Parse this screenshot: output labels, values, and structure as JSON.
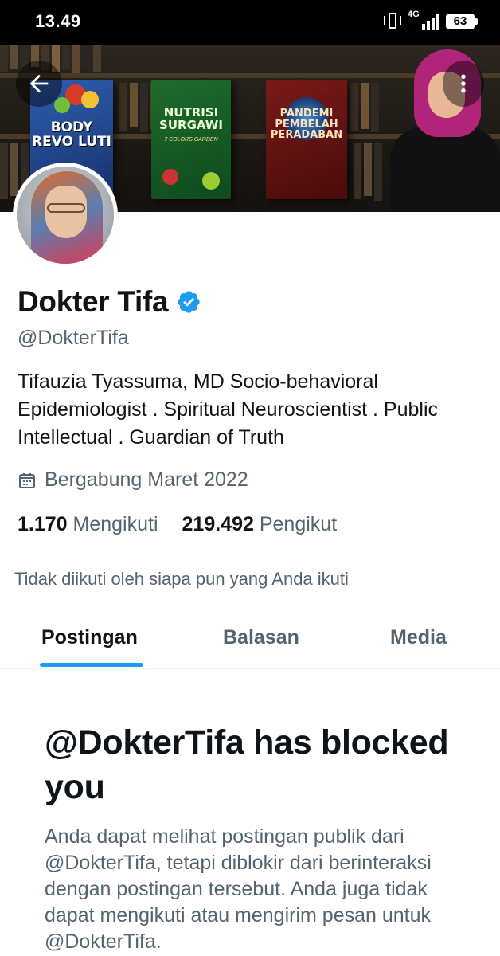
{
  "status_bar": {
    "time": "13.49",
    "network_label": "4G",
    "battery": "63"
  },
  "banner": {
    "books": [
      {
        "title": "BODY REVO LUTI",
        "subtitle": ""
      },
      {
        "title": "NUTRISI SURGAWI",
        "subtitle": "7 COLORS GARDEN"
      },
      {
        "title": "PANDEMI PEMBELAH PERADABAN",
        "subtitle": ""
      }
    ]
  },
  "profile": {
    "display_name": "Dokter Tifa",
    "verified": true,
    "handle": "@DokterTifa",
    "bio": "Tifauzia Tyassuma, MD Socio-behavioral Epidemiologist .  Spiritual Neuroscientist . Public Intellectual . Guardian of Truth",
    "joined": "Bergabung Maret 2022",
    "following_count": "1.170",
    "following_label": "Mengikuti",
    "followers_count": "219.492",
    "followers_label": "Pengikut",
    "followed_note": "Tidak diikuti oleh siapa pun yang Anda ikuti"
  },
  "tabs": [
    {
      "label": "Postingan",
      "active": true
    },
    {
      "label": "Balasan",
      "active": false
    },
    {
      "label": "Media",
      "active": false
    }
  ],
  "blocked": {
    "title": "@DokterTifa has blocked you",
    "text": "Anda dapat melihat postingan publik dari @DokterTifa, tetapi diblokir dari berinteraksi dengan postingan tersebut. Anda juga tidak dapat mengikuti atau mengirim pesan untuk @DokterTifa."
  },
  "colors": {
    "accent": "#1d9bf0",
    "secondary_text": "#536471",
    "primary_text": "#0f1419"
  },
  "icons": {
    "back": "arrow-left-icon",
    "more": "more-vertical-icon",
    "verified": "verified-badge-icon",
    "calendar": "calendar-icon"
  }
}
